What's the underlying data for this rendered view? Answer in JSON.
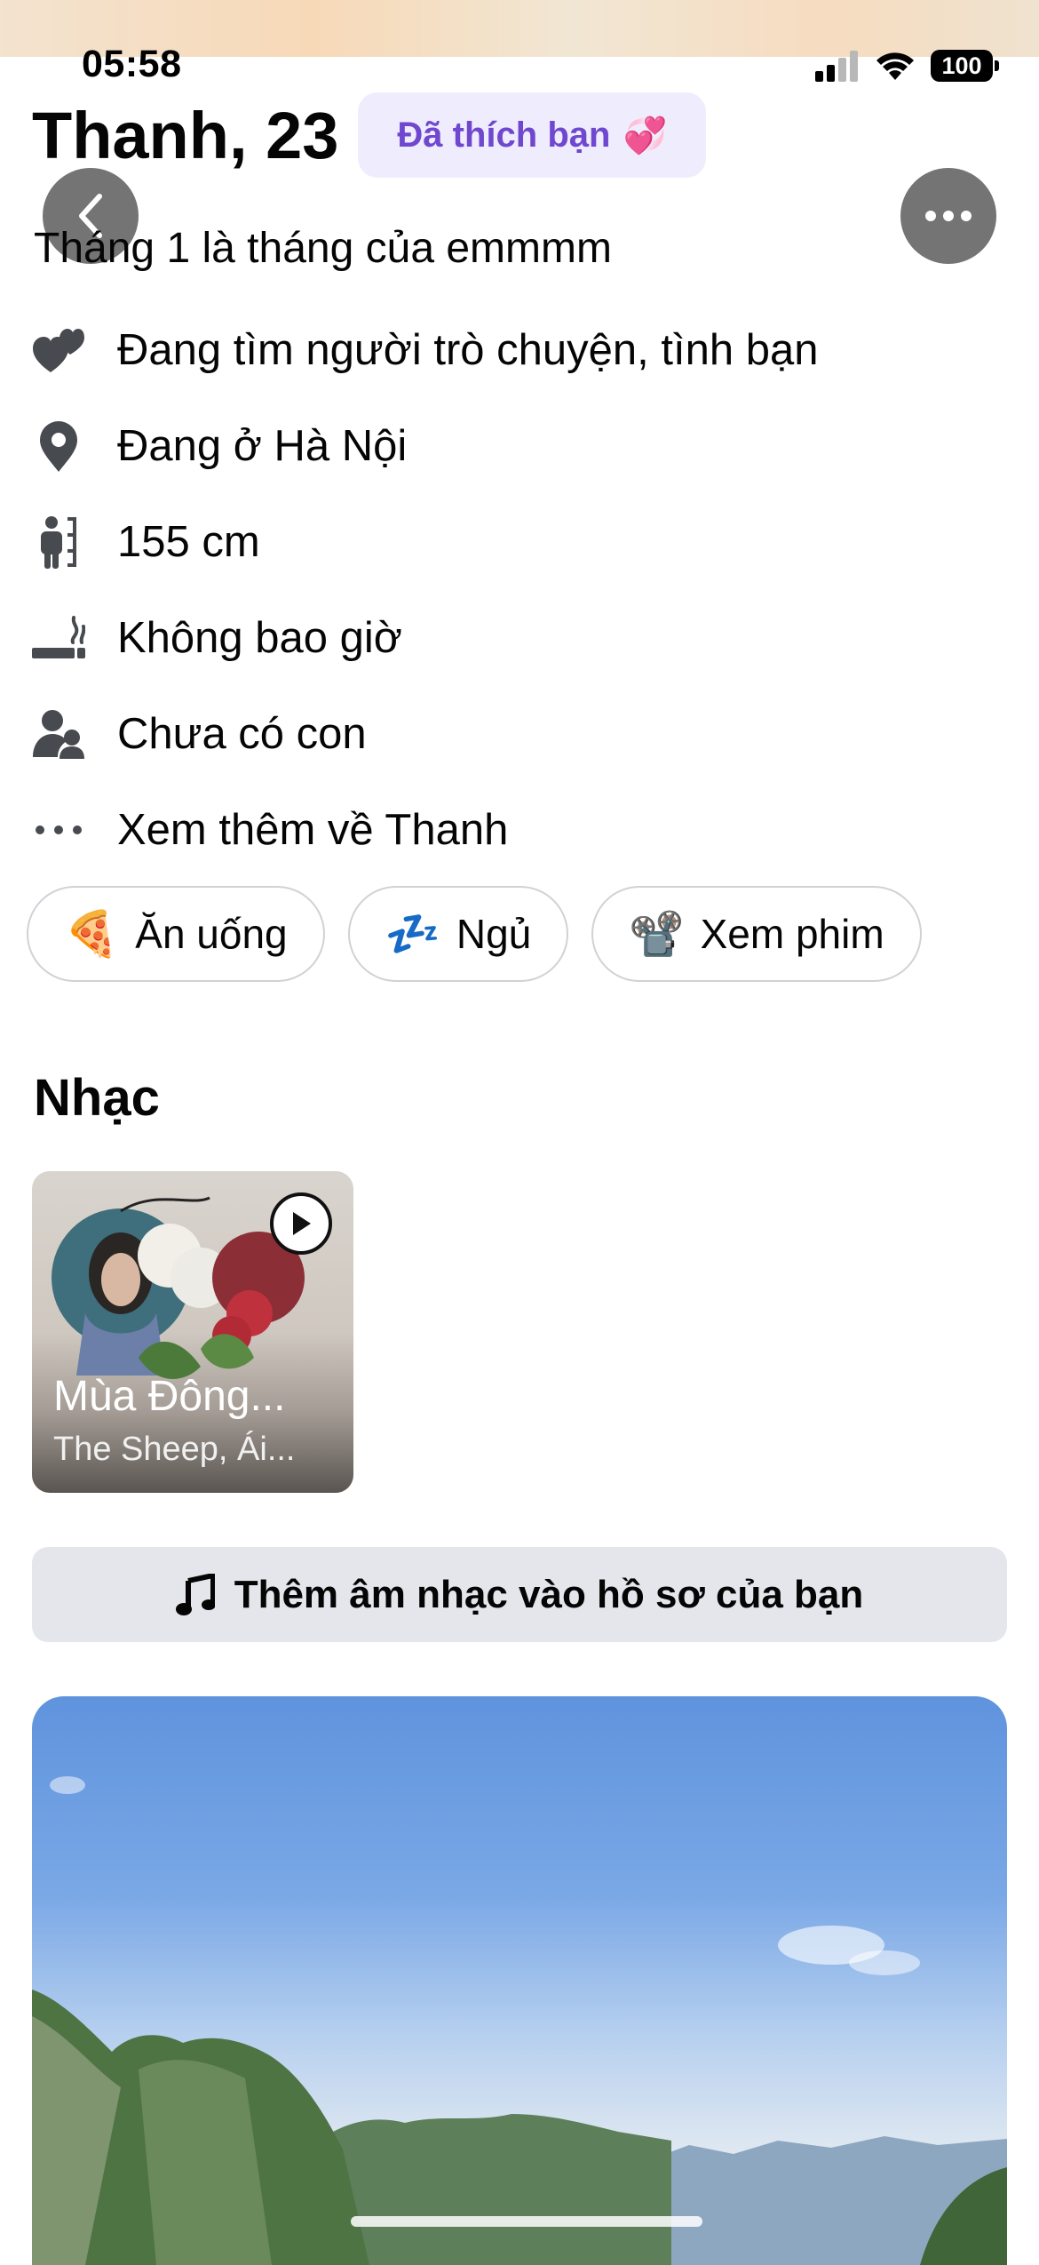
{
  "status_bar": {
    "time": "05:58",
    "battery": "100"
  },
  "profile": {
    "name_age": "Thanh, 23",
    "liked_badge": "Đã thích bạn",
    "liked_badge_emoji": "💞",
    "bio": "Tháng 1 là tháng của emmmm"
  },
  "info": [
    {
      "icon": "hearts-icon",
      "text": "Đang tìm người trò chuyện, tình bạn"
    },
    {
      "icon": "location-pin-icon",
      "text": "Đang ở Hà Nội"
    },
    {
      "icon": "height-icon",
      "text": "155 cm"
    },
    {
      "icon": "cigarette-icon",
      "text": "Không bao giờ"
    },
    {
      "icon": "children-icon",
      "text": "Chưa có con"
    },
    {
      "icon": "more-dots-icon",
      "text": "Xem thêm về Thanh"
    }
  ],
  "interests": [
    {
      "emoji": "🍕",
      "label": "Ăn uống"
    },
    {
      "emoji": "💤",
      "label": "Ngủ"
    },
    {
      "emoji": "📽️",
      "label": "Xem phim"
    }
  ],
  "music": {
    "section_title": "Nhạc",
    "song_title": "Mùa Đông...",
    "song_artist": "The Sheep, Ái...",
    "add_music_label": "Thêm âm nhạc vào hồ sơ của bạn"
  },
  "colors": {
    "badge_bg": "#efedfd",
    "badge_text": "#7048d0",
    "chip_border": "#cfd2d6",
    "add_music_bg": "#e4e6eb",
    "overlay_button": "#555555"
  }
}
